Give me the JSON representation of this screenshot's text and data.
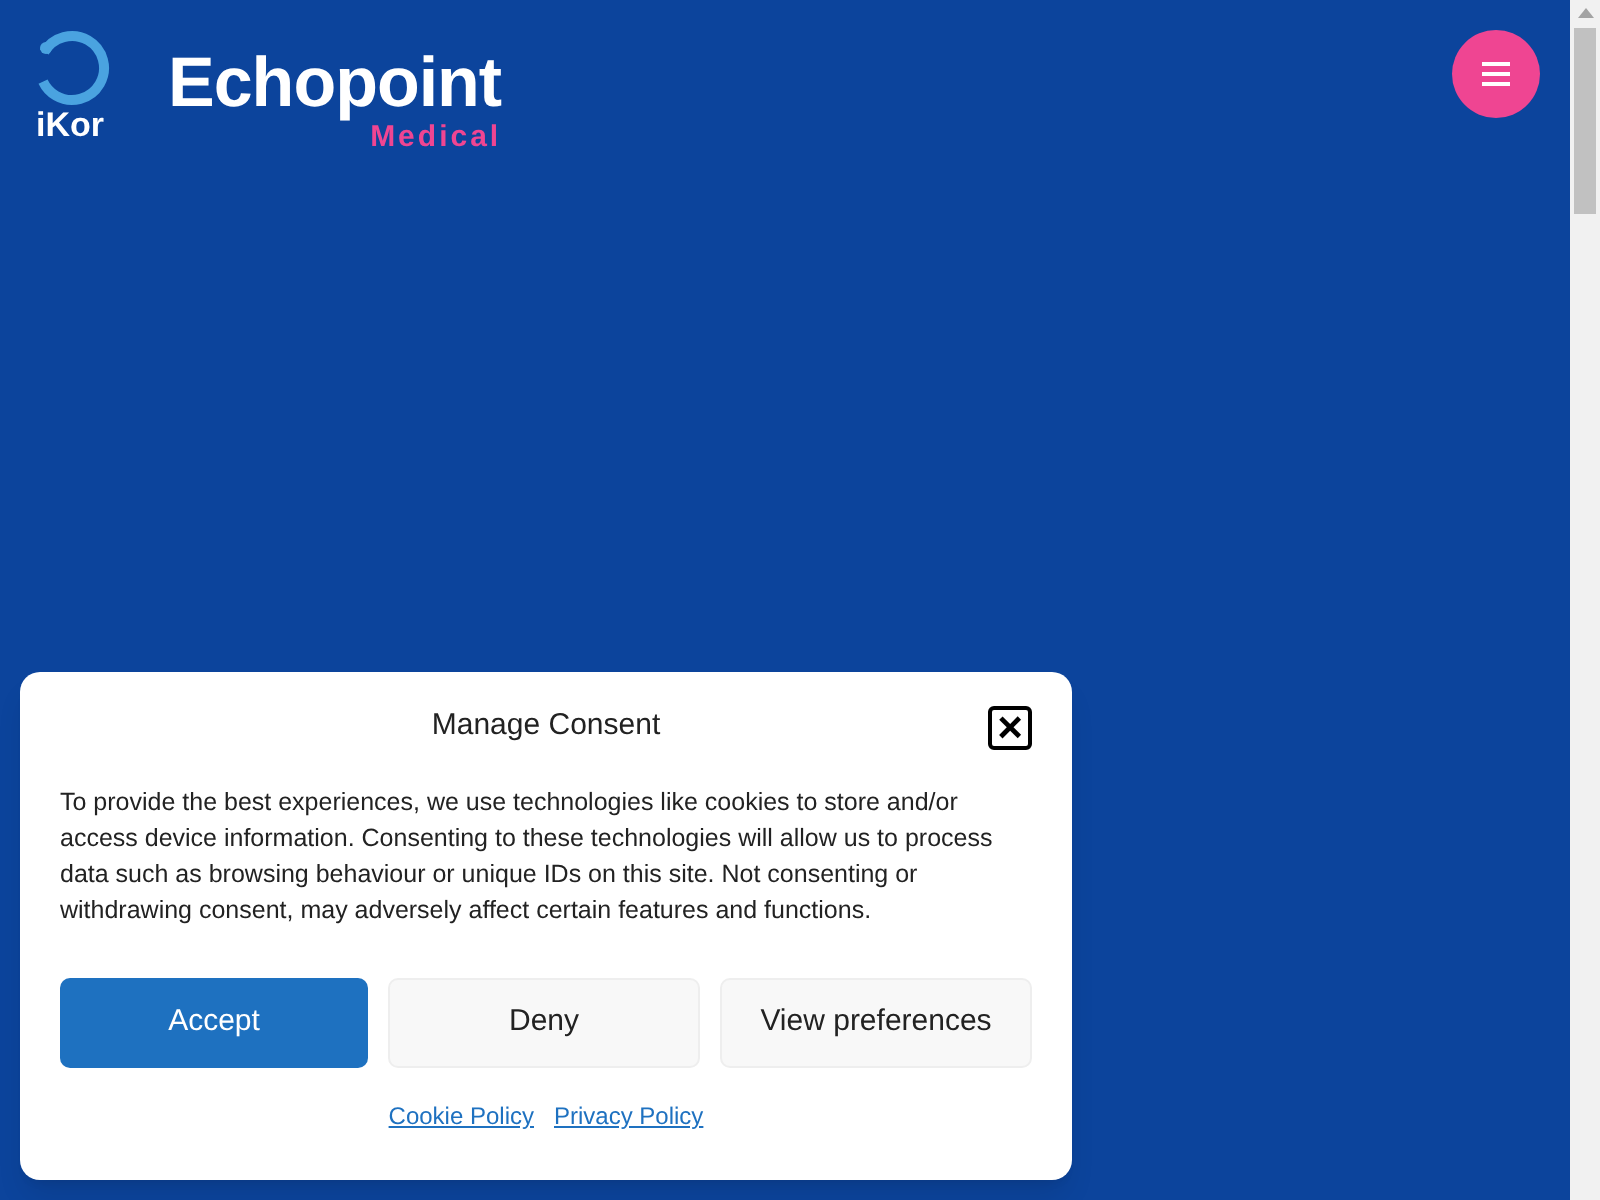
{
  "header": {
    "partner_logo": "iKor",
    "brand": "Echopoint",
    "brand_sub": "Medical"
  },
  "consent": {
    "title": "Manage Consent",
    "close": "×",
    "body": "To provide the best experiences, we use technologies like cookies to store and/or access device information. Consenting to these technologies will allow us to process data such as browsing behaviour or unique IDs on this site. Not consenting or withdrawing consent, may adversely affect certain features and functions.",
    "buttons": [
      {
        "label": "Accept",
        "kind": "primary"
      },
      {
        "label": "Deny",
        "kind": "secondary"
      },
      {
        "label": "View preferences",
        "kind": "secondary"
      }
    ],
    "links": [
      "Cookie Policy",
      "Privacy Policy"
    ]
  }
}
